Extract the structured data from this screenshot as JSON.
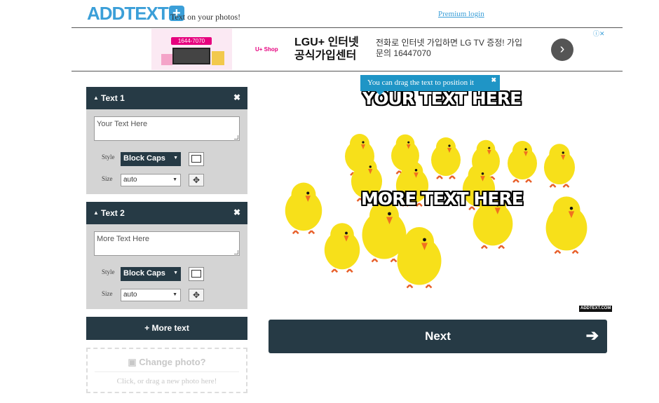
{
  "header": {
    "logo_text": "ADDTEXT",
    "logo_plus": "+",
    "tagline": "Text on your photos!",
    "premium_link": "Premium login"
  },
  "ad": {
    "phone": "1644-7070",
    "shop": "U+ Shop",
    "title": "LGU+ 인터넷 공식가입센터",
    "description": "전화로 인터넷 가입하면 LG TV 증정! 가입문의 16447070",
    "next_arrow": "›",
    "badge": "ⓘ✕"
  },
  "panels": [
    {
      "title": "Text 1",
      "close": "✖",
      "text_value": "Your Text Here",
      "style_label": "Style",
      "style_value": "Block Caps",
      "size_label": "Size",
      "size_value": "auto"
    },
    {
      "title": "Text 2",
      "close": "✖",
      "text_value": "More Text Here",
      "style_label": "Style",
      "style_value": "Block Caps",
      "size_label": "Size",
      "size_value": "auto"
    }
  ],
  "more_text_button": "+ More text",
  "change_photo": {
    "title": "Change photo?",
    "subtitle": "Click, or drag a new photo here!"
  },
  "tooltip": {
    "text": "You can drag the text to position it",
    "close": "✖"
  },
  "photo": {
    "overlay_top": "YOUR TEXT HERE",
    "overlay_bottom": "MORE TEXT HERE",
    "watermark": "ADDTEXT.COM"
  },
  "next_button": {
    "label": "Next",
    "arrow": "➔"
  },
  "colors": {
    "brand_blue": "#3b9fd8",
    "dark_panel": "#263a45",
    "tooltip_blue": "#1f95c6",
    "chick_yellow": "#f7e01a"
  }
}
